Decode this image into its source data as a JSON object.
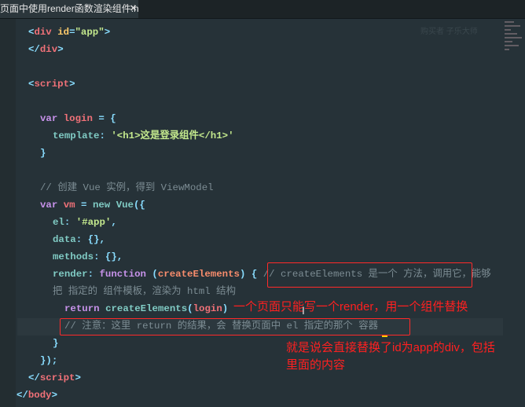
{
  "tab": {
    "title": "在页面中使用render函数渲染组件.html",
    "close_icon": "close-icon"
  },
  "watermark": "购买者 子乐大师",
  "code_lines": [
    {
      "y": 0,
      "indent": 36,
      "tokens": [
        [
          "<",
          "punct"
        ],
        [
          "div",
          "tag"
        ],
        [
          " ",
          "plain"
        ],
        [
          "id",
          "attr"
        ],
        [
          "=",
          "punct"
        ],
        [
          "\"app\"",
          "str"
        ],
        [
          ">",
          "punct"
        ]
      ]
    },
    {
      "y": 1,
      "indent": 36,
      "tokens": [
        [
          "</",
          "punct"
        ],
        [
          "div",
          "tag"
        ],
        [
          ">",
          "punct"
        ]
      ]
    },
    {
      "y": 3,
      "indent": 36,
      "tokens": [
        [
          "<",
          "punct"
        ],
        [
          "script",
          "tag"
        ],
        [
          ">",
          "punct"
        ]
      ]
    },
    {
      "y": 5,
      "indent": 51,
      "tokens": [
        [
          "var ",
          "kw"
        ],
        [
          "login",
          "var"
        ],
        [
          " = {",
          "punct"
        ]
      ]
    },
    {
      "y": 6,
      "indent": 67,
      "tokens": [
        [
          "template",
          "prop"
        ],
        [
          ": ",
          "punct"
        ],
        [
          "'<h1>这是登录组件</h1>'",
          "str"
        ]
      ]
    },
    {
      "y": 7,
      "indent": 51,
      "tokens": [
        [
          "}",
          "punct"
        ]
      ]
    },
    {
      "y": 9,
      "indent": 51,
      "tokens": [
        [
          "// 创建 Vue 实例，得到 ViewModel",
          "comment"
        ]
      ]
    },
    {
      "y": 10,
      "indent": 51,
      "tokens": [
        [
          "var ",
          "kw"
        ],
        [
          "vm",
          "var"
        ],
        [
          " = ",
          "punct"
        ],
        [
          "new ",
          "prop"
        ],
        [
          "Vue",
          "prop"
        ],
        [
          "({",
          "punct"
        ]
      ]
    },
    {
      "y": 11,
      "indent": 67,
      "tokens": [
        [
          "el",
          "prop"
        ],
        [
          ": ",
          "punct"
        ],
        [
          "'#app'",
          "str"
        ],
        [
          ",",
          "punct"
        ]
      ]
    },
    {
      "y": 12,
      "indent": 67,
      "tokens": [
        [
          "data",
          "prop"
        ],
        [
          ": {},",
          "punct"
        ]
      ]
    },
    {
      "y": 13,
      "indent": 67,
      "tokens": [
        [
          "methods",
          "prop"
        ],
        [
          ": {},",
          "punct"
        ]
      ]
    },
    {
      "y": 14,
      "indent": 67,
      "tokens": [
        [
          "render",
          "prop"
        ],
        [
          ": ",
          "punct"
        ],
        [
          "function ",
          "kw"
        ],
        [
          "(",
          "punct"
        ],
        [
          "createElements",
          "param"
        ],
        [
          ") { ",
          "punct"
        ],
        [
          "// createElements 是一个 方法，调用它，能够",
          "comment"
        ]
      ]
    },
    {
      "y": 15,
      "indent": 67,
      "tokens": [
        [
          "把 指定的 组件模板，渲染为 html 结构",
          "comment"
        ]
      ]
    },
    {
      "y": 16,
      "indent": 82,
      "tokens": [
        [
          "return ",
          "kw"
        ],
        [
          "createElements",
          "prop"
        ],
        [
          "(",
          "punct"
        ],
        [
          "login",
          "var"
        ],
        [
          ")",
          "punct"
        ]
      ]
    },
    {
      "y": 17,
      "indent": 82,
      "tokens": [
        [
          "// 注意：这里 return 的结果，会 替换页面中 el 指定的那个 容器",
          "comment"
        ]
      ]
    },
    {
      "y": 18,
      "indent": 67,
      "tokens": [
        [
          "}",
          "punct"
        ]
      ]
    },
    {
      "y": 19,
      "indent": 51,
      "tokens": [
        [
          "});",
          "punct"
        ]
      ]
    },
    {
      "y": 20,
      "indent": 36,
      "tokens": [
        [
          "</",
          "punct"
        ],
        [
          "script",
          "tag"
        ],
        [
          ">",
          "punct"
        ]
      ]
    },
    {
      "y": 21,
      "indent": 21,
      "tokens": [
        [
          "</",
          "punct"
        ],
        [
          "body",
          "tag"
        ],
        [
          ">",
          "punct"
        ]
      ]
    }
  ],
  "annotations": {
    "render_note": "一个页面只能写一个render，用一个组件替换",
    "replace_note_line1": "就是说会直接替换了id为app的div，包括",
    "replace_note_line2": "里面的内容"
  },
  "colors": {
    "background": "#263238",
    "annotation": "#ff2020"
  }
}
